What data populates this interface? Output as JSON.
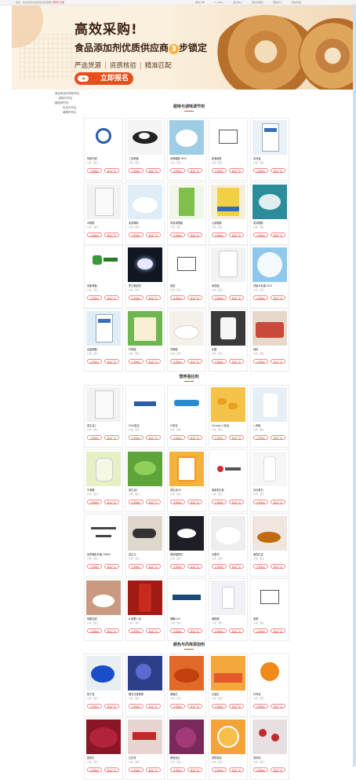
{
  "topbar": {
    "left_text": "您好，欢迎来到食品添加剂采购网 ",
    "left_links": [
      "请登录",
      "注册"
    ],
    "right_links": [
      "我的订单",
      "个人中心",
      "会员中心",
      "供应商服务",
      "帮助中心",
      "网站导航"
    ]
  },
  "banner": {
    "headline": "高效采购!",
    "sub_pre": "食品添加剂优质供应商",
    "sub_num": "3",
    "sub_post": "步锁定",
    "tags": [
      "严选货源",
      "资质核验",
      "精准匹配"
    ],
    "cta_label": "立即报名",
    "colors": {
      "cta": "#e84d1c",
      "accent": "#f7b244",
      "text": "#3d2314"
    }
  },
  "sidenav": [
    "食品添加剂采购专区",
    "甜味剂专区",
    "酸度调节剂",
    "乳化剂专区",
    "增稠剂专区",
    "营养强化剂"
  ],
  "card_buttons": {
    "primary": "立即询价",
    "secondary": "联系厂家"
  },
  "sections": [
    {
      "title": "甜味与调味调节剂",
      "items": [
        {
          "name": "阿斯巴甜",
          "meta": "价格：面议",
          "img": "logo"
        },
        {
          "name": "三氯蔗糖",
          "meta": "价格：面议",
          "img": "powder-dark"
        },
        {
          "name": "赤藓糖醇 99%",
          "meta": "价格：面议",
          "img": "powder-blue"
        },
        {
          "name": "甜菊糖苷",
          "meta": "价格：面议",
          "img": "formula"
        },
        {
          "name": "安赛蜜",
          "meta": "价格：面议",
          "img": "bag-blue"
        },
        {
          "name": "木糖醇",
          "meta": "价格：面议",
          "img": "bag"
        },
        {
          "name": "麦芽糊精",
          "meta": "价格：面议",
          "img": "crystal"
        },
        {
          "name": "异麦芽酮糖",
          "meta": "价格：面议",
          "img": "bag-green"
        },
        {
          "name": "山梨糖醇",
          "meta": "价格：面议",
          "img": "box-yellow"
        },
        {
          "name": "麦芽糖醇",
          "meta": "价格：面议",
          "img": "crystal-teal"
        },
        {
          "name": "低聚果糖",
          "meta": "价格：面议",
          "img": "logo-green"
        },
        {
          "name": "罗汉果甜苷",
          "meta": "价格：面议",
          "img": "dark-crystal"
        },
        {
          "name": "纽甜",
          "meta": "价格：面议",
          "img": "formula"
        },
        {
          "name": "海藻糖",
          "meta": "价格：面议",
          "img": "drum"
        },
        {
          "name": "低聚半乳糖 GOS",
          "meta": "价格：面议",
          "img": "gos"
        },
        {
          "name": "结晶果糖",
          "meta": "价格：面议",
          "img": "bag-blue2"
        },
        {
          "name": "柠檬酸",
          "meta": "价格：面议",
          "img": "sachet"
        },
        {
          "name": "苹果酸",
          "meta": "价格：面议",
          "img": "bowl"
        },
        {
          "name": "乳酸",
          "meta": "价格：面议",
          "img": "jar-dark"
        },
        {
          "name": "味精",
          "meta": "价格：面议",
          "img": "tray-red"
        }
      ]
    },
    {
      "title": "营养强化剂",
      "items": [
        {
          "name": "维生素C",
          "meta": "价格：面议",
          "img": "bag"
        },
        {
          "name": "DHA藻油",
          "meta": "价格：面议",
          "img": "logo-pharma"
        },
        {
          "name": "叶黄素",
          "meta": "价格：面议",
          "img": "logo-golden"
        },
        {
          "name": "Omega-3 鱼油",
          "meta": "价格：面议",
          "img": "caps-gold"
        },
        {
          "name": "L-肉碱",
          "meta": "价格：面议",
          "img": "bags-white"
        },
        {
          "name": "牛磺酸",
          "meta": "价格：面议",
          "img": "jar-clear"
        },
        {
          "name": "维生素E",
          "meta": "价格：面议",
          "img": "peas"
        },
        {
          "name": "维生素D3",
          "meta": "价格：面议",
          "img": "box-orange"
        },
        {
          "name": "胶原蛋白肽",
          "meta": "价格：面议",
          "img": "logo-red"
        },
        {
          "name": "乳清蛋白",
          "meta": "价格：面议",
          "img": "bottles"
        },
        {
          "name": "鼠李糖乳杆菌 LR863",
          "meta": "价格：面议",
          "img": "text-lr"
        },
        {
          "name": "益生元",
          "meta": "价格：面议",
          "img": "pills"
        },
        {
          "name": "葡萄糖酸锌",
          "meta": "价格：面议",
          "img": "crystal-dark"
        },
        {
          "name": "乳酸钙",
          "meta": "价格：面议",
          "img": "powder-white"
        },
        {
          "name": "番茄红素",
          "meta": "价格：面议",
          "img": "honey"
        },
        {
          "name": "硫酸亚铁",
          "meta": "价格：面议",
          "img": "bowl-white"
        },
        {
          "name": "β-胡萝卜素",
          "meta": "价格：面议",
          "img": "liquid-red"
        },
        {
          "name": "辅酶Q10",
          "meta": "价格：面议",
          "img": "logo-orlobest"
        },
        {
          "name": "烟酰胺",
          "meta": "价格：面议",
          "img": "bottle"
        },
        {
          "name": "肌醇",
          "meta": "价格：面议",
          "img": "formula2"
        }
      ]
    },
    {
      "title": "颜色与风味添加剂",
      "items": [
        {
          "name": "栀子蓝",
          "meta": "价格：面议",
          "img": "blue-powder"
        },
        {
          "name": "蝶豆花提取物",
          "meta": "价格：面议",
          "img": "flowers"
        },
        {
          "name": "辣椒红",
          "meta": "价格：面议",
          "img": "orange-powder"
        },
        {
          "name": "红曲红",
          "meta": "价格：面议",
          "img": "jars-color"
        },
        {
          "name": "叶黄素",
          "meta": "价格：面议",
          "img": "marigold"
        },
        {
          "name": "甜菜红",
          "meta": "价格：面议",
          "img": "red-powder"
        },
        {
          "name": "红花黄",
          "meta": "价格：面议",
          "img": "pills-red"
        },
        {
          "name": "葡萄皮红",
          "meta": "价格：面议",
          "img": "grape"
        },
        {
          "name": "柑橘香精",
          "meta": "价格：面议",
          "img": "orange"
        },
        {
          "name": "香草精",
          "meta": "价格：面议",
          "img": "red-items"
        }
      ]
    }
  ]
}
